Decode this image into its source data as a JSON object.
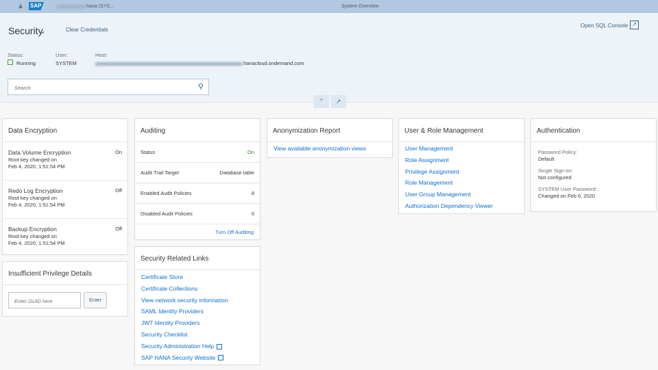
{
  "topbar": {
    "system_suffix": "-hana (SYS...",
    "title": "System Overview",
    "logo": "SAP"
  },
  "header": {
    "title": "Security",
    "clear_credentials": "Clear Credentials",
    "open_sql_console": "Open SQL Console",
    "status_label": "Status:",
    "status_value": "Running",
    "user_label": "User:",
    "user_value": "SYSTEM",
    "host_label": "Host:",
    "host_suffix": ".hanacloud.ondemand.com",
    "search_placeholder": "Search"
  },
  "data_encryption": {
    "title": "Data Encryption",
    "items": [
      {
        "name": "Data Volume Encryption",
        "state": "On",
        "line1": "Root key changed on",
        "line2": "Feb 4, 2020, 1:51:54 PM"
      },
      {
        "name": "Redo Log Encryption",
        "state": "Off",
        "line1": "Root key changed on",
        "line2": "Feb 4, 2020, 1:51:54 PM"
      },
      {
        "name": "Backup Encryption",
        "state": "Off",
        "line1": "Root key changed on",
        "line2": "Feb 4, 2020, 1:51:54 PM"
      }
    ]
  },
  "privilege": {
    "title": "Insufficient Privilege Details",
    "placeholder": "Enter GUID here",
    "enter": "Enter"
  },
  "auditing": {
    "title": "Auditing",
    "rows": [
      {
        "label": "Status",
        "value": "On"
      },
      {
        "label": "Audit Trail Target",
        "value": "Database table"
      },
      {
        "label": "Enabled Audit Policies",
        "value": "8"
      },
      {
        "label": "Disabled Audit Policies",
        "value": "0"
      }
    ],
    "turn_off": "Turn Off Auditing"
  },
  "links": {
    "title": "Security Related Links",
    "items": [
      "Certificate Store",
      "Certificate Collections",
      "View network security information",
      "SAML Identity Providers",
      "JWT Identity Providers",
      "Security Checklist",
      "Security Administration Help",
      "SAP HANA Security Website"
    ]
  },
  "anonymization": {
    "title": "Anonymization Report",
    "link": "View available anonymization views"
  },
  "user_role": {
    "title": "User & Role Management",
    "items": [
      "User Management",
      "Role Assignment",
      "Privilege Assignment",
      "Role Management",
      "User Group Management",
      "Authorization Dependency Viewer"
    ]
  },
  "authentication": {
    "title": "Authentication",
    "items": [
      {
        "label": "Password Policy:",
        "value": "Default"
      },
      {
        "label": "Single Sign-on:",
        "value": "Not configured"
      },
      {
        "label": "SYSTEM User Password:",
        "value": "Changed on Feb 6, 2020"
      }
    ]
  }
}
